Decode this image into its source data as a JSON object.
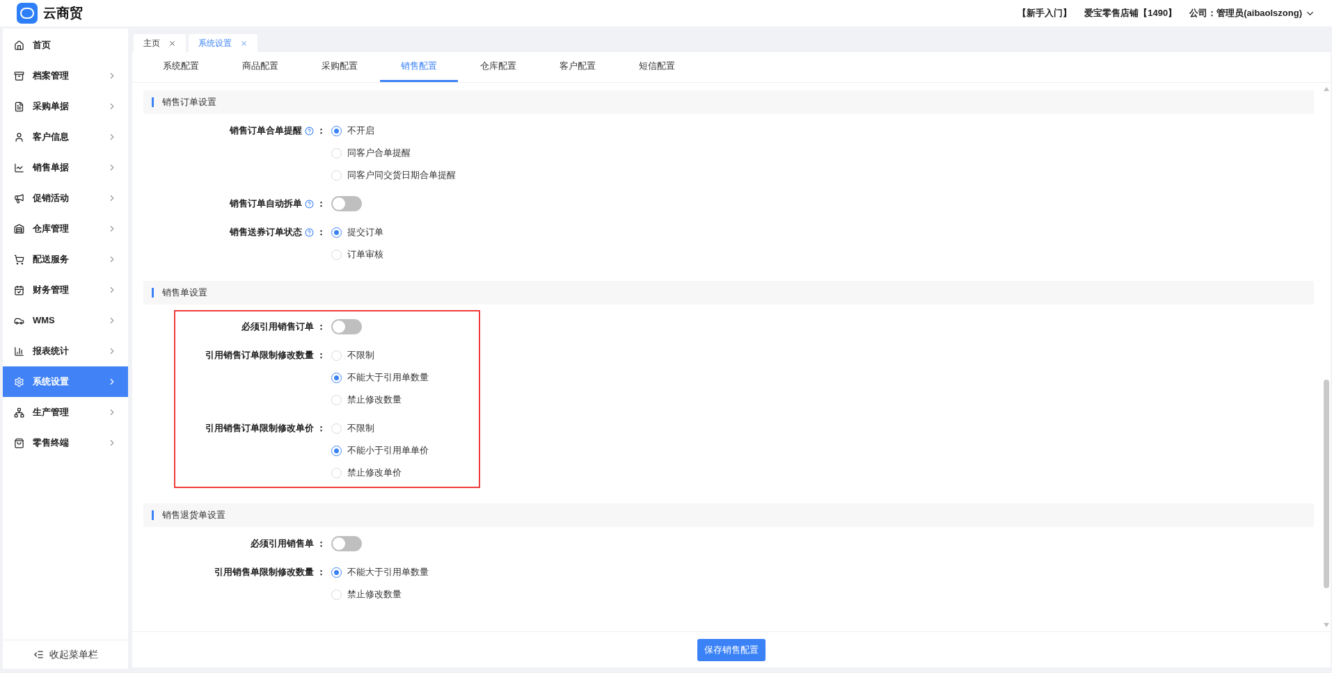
{
  "header": {
    "logo_text": "云商贸",
    "links": [
      "【新手入门】",
      "爱宝零售店铺【1490】",
      "公司：管理员(aibaolszong)"
    ]
  },
  "sidebar": {
    "items": [
      {
        "label": "首页",
        "selected": false,
        "arrow": false
      },
      {
        "label": "档案管理",
        "selected": false,
        "arrow": true
      },
      {
        "label": "采购单据",
        "selected": false,
        "arrow": true
      },
      {
        "label": "客户信息",
        "selected": false,
        "arrow": true
      },
      {
        "label": "销售单据",
        "selected": false,
        "arrow": true
      },
      {
        "label": "促销活动",
        "selected": false,
        "arrow": true
      },
      {
        "label": "仓库管理",
        "selected": false,
        "arrow": true
      },
      {
        "label": "配送服务",
        "selected": false,
        "arrow": true
      },
      {
        "label": "财务管理",
        "selected": false,
        "arrow": true
      },
      {
        "label": "WMS",
        "selected": false,
        "arrow": true
      },
      {
        "label": "报表统计",
        "selected": false,
        "arrow": true
      },
      {
        "label": "系统设置",
        "selected": true,
        "arrow": true
      },
      {
        "label": "生产管理",
        "selected": false,
        "arrow": true
      },
      {
        "label": "零售终端",
        "selected": false,
        "arrow": true
      }
    ],
    "collapse": "收起菜单栏"
  },
  "page_tabs": [
    {
      "label": "主页",
      "selected": false
    },
    {
      "label": "系统设置",
      "selected": true
    }
  ],
  "config_tabs": [
    {
      "label": "系统配置",
      "selected": false
    },
    {
      "label": "商品配置",
      "selected": false
    },
    {
      "label": "采购配置",
      "selected": false
    },
    {
      "label": "销售配置",
      "selected": true
    },
    {
      "label": "仓库配置",
      "selected": false
    },
    {
      "label": "客户配置",
      "selected": false
    },
    {
      "label": "短信配置",
      "selected": false
    }
  ],
  "sections": [
    {
      "title": "销售订单设置",
      "highlighted": false,
      "fields": [
        {
          "kind": "radio",
          "label": "销售订单合单提醒",
          "help": true,
          "colon": "：",
          "options": [
            {
              "label": "不开启",
              "selected": true
            },
            {
              "label": "同客户合单提醒",
              "selected": false
            },
            {
              "label": "同客户同交货日期合单提醒",
              "selected": false
            }
          ]
        },
        {
          "kind": "switch",
          "label": "销售订单自动拆单",
          "help": true,
          "colon": "：",
          "on": false
        },
        {
          "kind": "radio",
          "label": "销售送券订单状态",
          "help": true,
          "colon": "：",
          "options": [
            {
              "label": "提交订单",
              "selected": true
            },
            {
              "label": "订单审核",
              "selected": false
            }
          ]
        }
      ]
    },
    {
      "title": "销售单设置",
      "highlighted": true,
      "fields": [
        {
          "kind": "switch",
          "label": "必须引用销售订单",
          "help": false,
          "colon": "：",
          "on": false
        },
        {
          "kind": "radio",
          "label": "引用销售订单限制修改数量",
          "help": false,
          "colon": "：",
          "options": [
            {
              "label": "不限制",
              "selected": false
            },
            {
              "label": "不能大于引用单数量",
              "selected": true
            },
            {
              "label": "禁止修改数量",
              "selected": false
            }
          ]
        },
        {
          "kind": "radio",
          "label": "引用销售订单限制修改单价",
          "help": false,
          "colon": "：",
          "options": [
            {
              "label": "不限制",
              "selected": false
            },
            {
              "label": "不能小于引用单单价",
              "selected": true
            },
            {
              "label": "禁止修改单价",
              "selected": false
            }
          ]
        }
      ]
    },
    {
      "title": "销售退货单设置",
      "highlighted": false,
      "fields": [
        {
          "kind": "switch",
          "label": "必须引用销售单",
          "help": false,
          "colon": "：",
          "on": false
        },
        {
          "kind": "radio",
          "label": "引用销售单限制修改数量",
          "help": false,
          "colon": "：",
          "options": [
            {
              "label": "不能大于引用单数量",
              "selected": true
            },
            {
              "label": "禁止修改数量",
              "selected": false
            }
          ]
        }
      ]
    }
  ],
  "save_button": "保存销售配置"
}
